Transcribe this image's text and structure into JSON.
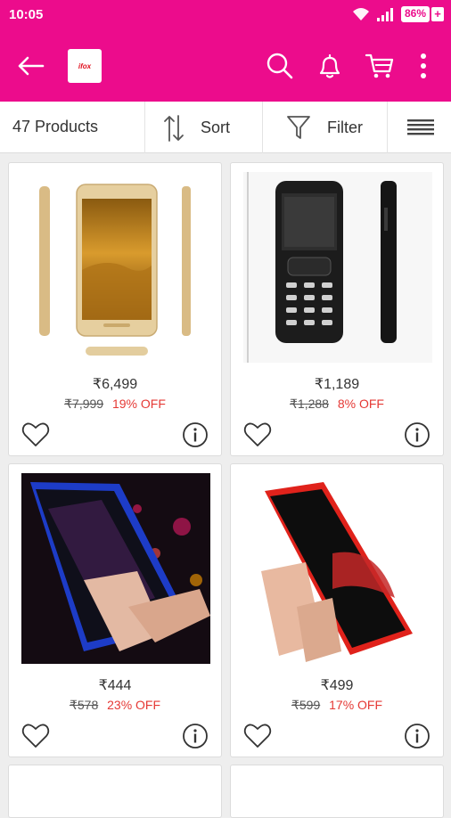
{
  "status_bar": {
    "time": "10:05",
    "battery": "86%",
    "battery_plus": "+"
  },
  "app_bar": {
    "logo_text": "ifox"
  },
  "toolbar": {
    "product_count": "47 Products",
    "sort_label": "Sort",
    "filter_label": "Filter"
  },
  "products": [
    {
      "price": "₹6,499",
      "mrp": "₹7,999",
      "discount": "19% OFF"
    },
    {
      "price": "₹1,189",
      "mrp": "₹1,288",
      "discount": "8% OFF"
    },
    {
      "price": "₹444",
      "mrp": "₹578",
      "discount": "23% OFF"
    },
    {
      "price": "₹499",
      "mrp": "₹599",
      "discount": "17% OFF"
    }
  ],
  "colors": {
    "brand": "#ec0c8c",
    "discount": "#e53935"
  }
}
